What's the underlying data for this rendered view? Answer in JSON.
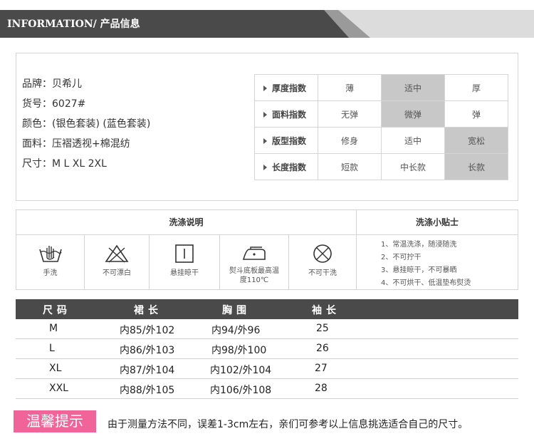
{
  "header": {
    "title": "INFORMATION/ 产品信息"
  },
  "product_info": {
    "brand": "品牌：贝希儿",
    "item_no": "货号：6027#",
    "color": "颜色：(银色套装) (蓝色套装)",
    "fabric": "面料：压褶透视+棉混纺",
    "sizes": "尺寸：M  L  XL 2XL"
  },
  "index_table": [
    {
      "label": "厚度指数",
      "options": [
        "薄",
        "适中",
        "厚"
      ],
      "selected": 1
    },
    {
      "label": "面料指数",
      "options": [
        "无弹",
        "微弹",
        "弹"
      ],
      "selected": 1
    },
    {
      "label": "版型指数",
      "options": [
        "修身",
        "适中",
        "宽松"
      ],
      "selected": 2
    },
    {
      "label": "长度指数",
      "options": [
        "短款",
        "中长款",
        "长款"
      ],
      "selected": 2
    }
  ],
  "wash": {
    "title": "洗涤说明",
    "tips_title": "洗涤小贴士",
    "items": [
      {
        "icon": "hand-wash-icon",
        "label": "手洗"
      },
      {
        "icon": "no-bleach-icon",
        "label": "不可漂白"
      },
      {
        "icon": "hang-dry-icon",
        "label": "悬挂晾干"
      },
      {
        "icon": "iron-icon",
        "label": "熨斗底板最高温度110℃"
      },
      {
        "icon": "no-dry-clean-icon",
        "label": "不可干洗"
      }
    ],
    "tips": [
      "1、常温洗涤，随浸随洗",
      "2、不可拧干",
      "3、悬挂晾干，不可暴晒",
      "4、不可烘干、低温垫布熨烫"
    ]
  },
  "size_table": {
    "headers": [
      "尺码",
      "裙长",
      "胸围",
      "袖长"
    ],
    "rows": [
      [
        "M",
        "内85/外102",
        "内94/外96",
        "25"
      ],
      [
        "L",
        "内86/外103",
        "内98/外100",
        "26"
      ],
      [
        "XL",
        "内87/外104",
        "内102/外104",
        "27"
      ],
      [
        "XXL",
        "内88/外105",
        "内106/外108",
        "28"
      ]
    ]
  },
  "notice": {
    "badge": "温馨提示",
    "text": "由于测量方法不同，误差1-3cm左右，亲们可参考以上信息挑选适合自己的尺寸。"
  }
}
